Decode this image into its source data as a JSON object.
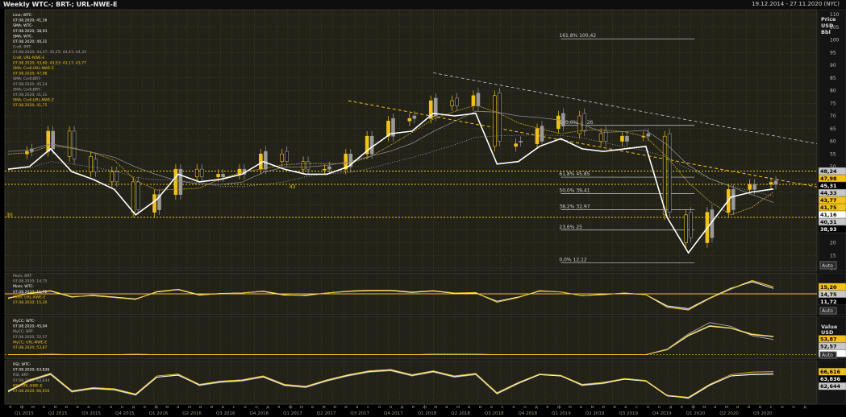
{
  "window": {
    "title": "Weekly WTC-; BRT-; URL-NWE-E",
    "date_range": "19.12.2014 - 27.11.2020 (NYC)"
  },
  "colors": {
    "background": "#000000",
    "panel": "#222219",
    "white_series": "#ffffff",
    "yellow_series": "#f2c21a",
    "gold_series": "#c9a227",
    "grid": "#5a5a40"
  },
  "price_panel": {
    "legend": [
      {
        "text": "Line; WTC-",
        "color": "#ffffff"
      },
      {
        "text": "07.08.2020; 41,16",
        "color": "#ffffff"
      },
      {
        "text": "SMA; WTC-",
        "color": "#ffffff"
      },
      {
        "text": "07.08.2020; 38,93",
        "color": "#ffffff"
      },
      {
        "text": "SMA; WTC-",
        "color": "#ffffff"
      },
      {
        "text": "07.08.2020; 40,31",
        "color": "#ffffff"
      },
      {
        "text": "Cndl; BRT-",
        "color": "#aaaaaa"
      },
      {
        "text": "07.08.2020; 44,47; 45,25; 44,43; 44,33",
        "color": "#aaaaaa"
      },
      {
        "text": "Cndl; URL-NWE-E",
        "color": "#f2c21a"
      },
      {
        "text": "07.08.2020; 43,60; 43,53; 43,17; 43,77",
        "color": "#f2c21a"
      },
      {
        "text": "SMA; Cndl;URL-NWE-E",
        "color": "#f2c21a"
      },
      {
        "text": "07.08.2020; 47,98",
        "color": "#f2c21a"
      },
      {
        "text": "SMA; Cndl;BRT-",
        "color": "#aaaaaa"
      },
      {
        "text": "07.08.2020; 45,24",
        "color": "#aaaaaa"
      },
      {
        "text": "SMA; Cndl;BRT-",
        "color": "#aaaaaa"
      },
      {
        "text": "07.08.2020; 41,31",
        "color": "#aaaaaa"
      },
      {
        "text": "SMA; Cndl;URL-NWE-E",
        "color": "#f2c21a"
      },
      {
        "text": "07.08.2020; 41,75",
        "color": "#f2c21a"
      }
    ],
    "axis_header": [
      "Price",
      "USD",
      "Bbl"
    ],
    "auto_button": "Auto",
    "level_left_label": "30",
    "level_43_label": "43",
    "fib_levels": [
      {
        "pct": "161,8%",
        "value": "100,42"
      },
      {
        "pct": "100,0%",
        "value": "66,26"
      },
      {
        "pct": "61,8%",
        "value": "45,85"
      },
      {
        "pct": "50,0%",
        "value": "39,41"
      },
      {
        "pct": "38,2%",
        "value": "32,97"
      },
      {
        "pct": "23,6%",
        "value": "25"
      },
      {
        "pct": "0,0%",
        "value": "12,12"
      }
    ],
    "value_tags": [
      {
        "text": "48,24",
        "y": 48.24,
        "bg": "#c8c8c8",
        "fg": "#000000"
      },
      {
        "text": "47,98",
        "y": 47.98,
        "bg": "#f2c21a",
        "fg": "#000000"
      },
      {
        "text": "45,31",
        "y": 45.31,
        "bg": "#000000",
        "fg": "#ffffff"
      },
      {
        "text": "44,33",
        "y": 44.33,
        "bg": "#c8c8c8",
        "fg": "#000000"
      },
      {
        "text": "43,77",
        "y": 43.77,
        "bg": "#f2c21a",
        "fg": "#000000"
      },
      {
        "text": "41,75",
        "y": 41.75,
        "bg": "#f2c21a",
        "fg": "#000000"
      },
      {
        "text": "40,31",
        "y": 40.31,
        "bg": "#c8c8c8",
        "fg": "#000000"
      },
      {
        "text": "41,16",
        "y": 41.16,
        "bg": "#ffffff",
        "fg": "#000000"
      },
      {
        "text": "38,93",
        "y": 38.93,
        "bg": "#000000",
        "fg": "#ffffff"
      }
    ]
  },
  "mom_panel": {
    "legend": [
      {
        "text": "Mom; BRT-",
        "color": "#aaaaaa"
      },
      {
        "text": "07.08.2020; 14,75",
        "color": "#aaaaaa"
      },
      {
        "text": "Mom; WTC-",
        "color": "#ffffff"
      },
      {
        "text": "07.08.2020; 11,72",
        "color": "#ffffff"
      },
      {
        "text": "Mom; URL-NWE-E",
        "color": "#f2c21a"
      },
      {
        "text": "07.08.2020; 15,20",
        "color": "#f2c21a"
      }
    ],
    "value_tags": [
      {
        "text": "14,75",
        "y": 14.75,
        "bg": "#c8c8c8",
        "fg": "#000000"
      },
      {
        "text": "15,20",
        "y": 15.2,
        "bg": "#f2c21a",
        "fg": "#000000"
      },
      {
        "text": "11,72",
        "y": 11.72,
        "bg": "#000000",
        "fg": "#ffffff"
      }
    ],
    "auto_button": "Auto"
  },
  "macd_panel": {
    "legend": [
      {
        "text": "MyCC; WTC-",
        "color": "#ffffff"
      },
      {
        "text": "07.08.2020; 45,04",
        "color": "#ffffff"
      },
      {
        "text": "MyCC; BRT-",
        "color": "#aaaaaa"
      },
      {
        "text": "07.08.2020; 52,57",
        "color": "#aaaaaa"
      },
      {
        "text": "MyCC; URL-NWE-E",
        "color": "#f2c21a"
      },
      {
        "text": "07.08.2020; 53,87",
        "color": "#f2c21a"
      }
    ],
    "axis_header": [
      "Value",
      "USD",
      "Bbl"
    ],
    "value_tags": [
      {
        "text": "53,87",
        "y": 53.87,
        "bg": "#f2c21a",
        "fg": "#000000"
      },
      {
        "text": "52,57",
        "y": 52.57,
        "bg": "#c8c8c8",
        "fg": "#000000"
      },
      {
        "text": "45,04",
        "y": 45.04,
        "bg": "#ffffff",
        "fg": "#000000"
      }
    ],
    "auto_button": "Auto"
  },
  "rsi_panel": {
    "legend": [
      {
        "text": "RSI; WTC-",
        "color": "#ffffff"
      },
      {
        "text": "07.08.2020; 63,836",
        "color": "#ffffff"
      },
      {
        "text": "RSI; BRT-",
        "color": "#aaaaaa"
      },
      {
        "text": "07.08.2020; 62,644",
        "color": "#aaaaaa"
      },
      {
        "text": "RSI; URL-NWE-E",
        "color": "#f2c21a"
      },
      {
        "text": "07.08.2020; 66,616",
        "color": "#f2c21a"
      }
    ],
    "axis_header": [
      "Bbl"
    ],
    "value_tags": [
      {
        "text": "62,644",
        "y": 62.644,
        "bg": "#c8c8c8",
        "fg": "#000000"
      },
      {
        "text": "66,616",
        "y": 66.616,
        "bg": "#f2c21a",
        "fg": "#000000"
      },
      {
        "text": "63,836",
        "y": 63.836,
        "bg": "#000000",
        "fg": "#ffffff"
      }
    ]
  },
  "month_letters": [
    "я",
    "ф",
    "м",
    "а",
    "м",
    "и",
    "и",
    "а",
    "с",
    "о",
    "н",
    "д"
  ],
  "quarter_labels": [
    "Q1 2015",
    "Q2 2015",
    "Q3 2015",
    "Q4 2015",
    "Q1 2016",
    "Q2 2016",
    "Q3 2016",
    "Q4 2016",
    "Q1 2017",
    "Q2 2017",
    "Q3 2017",
    "Q4 2017",
    "Q1 2018",
    "Q2 2018",
    "Q3 2018",
    "Q4 2018",
    "Q1 2019",
    "Q2 2019",
    "Q3 2019",
    "Q4 2019",
    "Q1 2020",
    "Q2 2020",
    "Q3 2020"
  ],
  "chart_data": [
    {
      "type": "line",
      "title": "Weekly WTC-; BRT-; URL-NWE-E",
      "ylabel": "Price USD Bbl",
      "ylim": [
        10,
        110
      ],
      "yticks": [
        10,
        15,
        20,
        25,
        30,
        35,
        40,
        45,
        50,
        55,
        60,
        65,
        70,
        75,
        80,
        85,
        90,
        95,
        100,
        105,
        110
      ],
      "x_start": "2014-12-19",
      "x_end": "2020-11-27",
      "x": [
        "2015-01",
        "2015-03",
        "2015-05",
        "2015-07",
        "2015-09",
        "2015-11",
        "2016-01",
        "2016-03",
        "2016-05",
        "2016-07",
        "2016-09",
        "2016-11",
        "2017-01",
        "2017-03",
        "2017-05",
        "2017-07",
        "2017-09",
        "2017-11",
        "2018-01",
        "2018-03",
        "2018-05",
        "2018-07",
        "2018-09",
        "2018-11",
        "2019-01",
        "2019-03",
        "2019-05",
        "2019-07",
        "2019-09",
        "2019-11",
        "2020-01",
        "2020-03",
        "2020-04",
        "2020-05",
        "2020-06",
        "2020-07",
        "2020-08"
      ],
      "series": [
        {
          "name": "WTC-",
          "values": [
            49,
            50,
            57,
            48,
            45,
            41,
            31,
            37,
            47,
            44,
            45,
            47,
            52,
            49,
            47,
            47,
            50,
            57,
            63,
            64,
            71,
            70,
            71,
            51,
            52,
            58,
            61,
            57,
            56,
            57,
            58,
            30,
            16,
            27,
            38,
            40,
            41.16
          ]
        },
        {
          "name": "BRT-",
          "values": [
            56,
            57,
            64,
            53,
            48,
            44,
            33,
            39,
            49,
            46,
            47,
            49,
            56,
            52,
            49,
            50,
            55,
            62,
            69,
            70,
            77,
            74,
            79,
            60,
            60,
            66,
            71,
            64,
            60,
            62,
            63,
            32,
            22,
            33,
            41,
            43,
            44.33
          ]
        },
        {
          "name": "URL-NWE-E",
          "values": [
            55,
            56,
            64,
            54,
            48,
            44,
            32,
            39,
            49,
            46,
            47,
            49,
            55,
            52,
            49,
            49,
            55,
            62,
            68,
            69,
            76,
            74,
            78,
            58,
            59,
            65,
            70,
            63,
            60,
            62,
            62,
            31,
            20,
            32,
            41,
            43,
            43.77
          ]
        }
      ],
      "horizontal_levels": [
        30,
        43,
        48.24
      ],
      "trendlines": [
        "downtrend from 2018 high",
        "support from 2017 to 2020"
      ],
      "fibonacci": {
        "0,0%": 12.12,
        "23,6%": 25,
        "38,2%": 32.97,
        "50,0%": 39.41,
        "61,8%": 45.85,
        "100,0%": 66.26,
        "161,8%": 100.42
      }
    },
    {
      "type": "line",
      "title": "Mom",
      "ylim": [
        -40,
        40
      ],
      "yticks": [
        -40,
        -20,
        0,
        20
      ],
      "series": [
        {
          "name": "Mom; BRT-",
          "values": [
            -10,
            2,
            6,
            -6,
            -4,
            -8,
            -12,
            4,
            10,
            -2,
            0,
            2,
            6,
            -2,
            -4,
            2,
            6,
            8,
            8,
            4,
            6,
            2,
            2,
            -18,
            -8,
            6,
            4,
            -4,
            -2,
            2,
            -2,
            -28,
            -34,
            -10,
            10,
            28,
            14.75
          ]
        },
        {
          "name": "Mom; WTC-",
          "values": [
            -9,
            1,
            6,
            -7,
            -3,
            -7,
            -11,
            4,
            9,
            -3,
            1,
            2,
            5,
            -3,
            -3,
            2,
            5,
            7,
            7,
            3,
            6,
            1,
            2,
            -16,
            -7,
            6,
            4,
            -4,
            -1,
            1,
            -2,
            -26,
            -32,
            -9,
            12,
            26,
            11.72
          ]
        },
        {
          "name": "Mom; URL-NWE-E",
          "values": [
            -10,
            2,
            7,
            -6,
            -4,
            -8,
            -12,
            5,
            10,
            -2,
            0,
            2,
            6,
            -2,
            -4,
            2,
            6,
            8,
            8,
            4,
            7,
            2,
            3,
            -18,
            -8,
            7,
            4,
            -4,
            -2,
            2,
            -2,
            -29,
            -35,
            -10,
            11,
            29,
            15.2
          ]
        }
      ]
    },
    {
      "type": "line",
      "title": "MyCC",
      "ylim": [
        0,
        100
      ],
      "series": [
        {
          "name": "MyCC; WTC-",
          "values": [
            5,
            5,
            6,
            5,
            5,
            5,
            6,
            5,
            5,
            5,
            5,
            5,
            5,
            5,
            5,
            5,
            5,
            5,
            5,
            5,
            6,
            6,
            6,
            5,
            5,
            5,
            5,
            5,
            5,
            5,
            5,
            20,
            60,
            90,
            80,
            55,
            45.04
          ]
        },
        {
          "name": "MyCC; BRT-",
          "values": [
            5,
            5,
            6,
            5,
            5,
            5,
            6,
            5,
            5,
            5,
            5,
            5,
            5,
            5,
            5,
            5,
            5,
            5,
            5,
            5,
            6,
            6,
            6,
            5,
            5,
            5,
            5,
            5,
            5,
            5,
            5,
            18,
            55,
            80,
            75,
            58,
            52.57
          ]
        },
        {
          "name": "MyCC; URL-NWE-E",
          "values": [
            5,
            5,
            6,
            5,
            5,
            5,
            6,
            5,
            5,
            5,
            5,
            5,
            5,
            5,
            5,
            5,
            5,
            5,
            5,
            5,
            6,
            6,
            6,
            5,
            5,
            5,
            5,
            5,
            5,
            5,
            5,
            19,
            57,
            82,
            76,
            60,
            53.87
          ]
        }
      ]
    },
    {
      "type": "line",
      "title": "RSI",
      "ylim": [
        20,
        80
      ],
      "series": [
        {
          "name": "RSI; WTC-",
          "values": [
            35,
            52,
            62,
            35,
            40,
            38,
            30,
            58,
            62,
            45,
            50,
            52,
            58,
            45,
            42,
            52,
            60,
            66,
            68,
            60,
            66,
            58,
            62,
            32,
            48,
            62,
            60,
            45,
            48,
            55,
            52,
            30,
            25,
            45,
            60,
            63,
            63.836
          ]
        },
        {
          "name": "RSI; BRT-",
          "values": [
            36,
            53,
            63,
            36,
            41,
            39,
            31,
            58,
            61,
            46,
            51,
            53,
            59,
            46,
            43,
            53,
            61,
            67,
            69,
            61,
            67,
            59,
            63,
            33,
            49,
            62,
            60,
            46,
            49,
            55,
            52,
            29,
            26,
            46,
            60,
            62,
            62.644
          ]
        },
        {
          "name": "RSI; URL-NWE-E",
          "values": [
            37,
            54,
            64,
            37,
            42,
            40,
            32,
            60,
            63,
            47,
            52,
            54,
            60,
            47,
            44,
            54,
            62,
            68,
            70,
            62,
            68,
            60,
            64,
            34,
            50,
            63,
            61,
            47,
            50,
            56,
            53,
            30,
            27,
            47,
            62,
            66,
            66.616
          ]
        }
      ]
    }
  ]
}
